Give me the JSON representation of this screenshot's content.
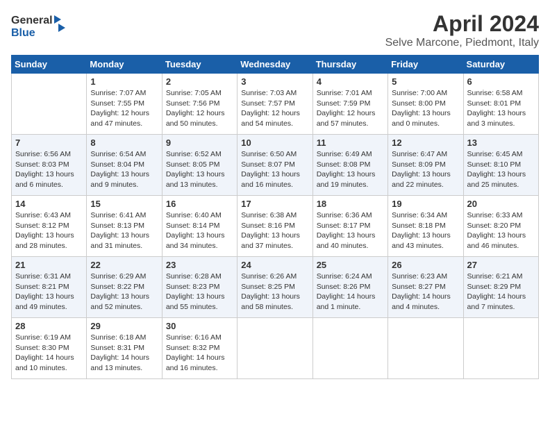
{
  "logo": {
    "line1": "General",
    "line2": "Blue"
  },
  "title": "April 2024",
  "subtitle": "Selve Marcone, Piedmont, Italy",
  "weekdays": [
    "Sunday",
    "Monday",
    "Tuesday",
    "Wednesday",
    "Thursday",
    "Friday",
    "Saturday"
  ],
  "weeks": [
    [
      {
        "day": "",
        "info": ""
      },
      {
        "day": "1",
        "info": "Sunrise: 7:07 AM\nSunset: 7:55 PM\nDaylight: 12 hours\nand 47 minutes."
      },
      {
        "day": "2",
        "info": "Sunrise: 7:05 AM\nSunset: 7:56 PM\nDaylight: 12 hours\nand 50 minutes."
      },
      {
        "day": "3",
        "info": "Sunrise: 7:03 AM\nSunset: 7:57 PM\nDaylight: 12 hours\nand 54 minutes."
      },
      {
        "day": "4",
        "info": "Sunrise: 7:01 AM\nSunset: 7:59 PM\nDaylight: 12 hours\nand 57 minutes."
      },
      {
        "day": "5",
        "info": "Sunrise: 7:00 AM\nSunset: 8:00 PM\nDaylight: 13 hours\nand 0 minutes."
      },
      {
        "day": "6",
        "info": "Sunrise: 6:58 AM\nSunset: 8:01 PM\nDaylight: 13 hours\nand 3 minutes."
      }
    ],
    [
      {
        "day": "7",
        "info": "Sunrise: 6:56 AM\nSunset: 8:03 PM\nDaylight: 13 hours\nand 6 minutes."
      },
      {
        "day": "8",
        "info": "Sunrise: 6:54 AM\nSunset: 8:04 PM\nDaylight: 13 hours\nand 9 minutes."
      },
      {
        "day": "9",
        "info": "Sunrise: 6:52 AM\nSunset: 8:05 PM\nDaylight: 13 hours\nand 13 minutes."
      },
      {
        "day": "10",
        "info": "Sunrise: 6:50 AM\nSunset: 8:07 PM\nDaylight: 13 hours\nand 16 minutes."
      },
      {
        "day": "11",
        "info": "Sunrise: 6:49 AM\nSunset: 8:08 PM\nDaylight: 13 hours\nand 19 minutes."
      },
      {
        "day": "12",
        "info": "Sunrise: 6:47 AM\nSunset: 8:09 PM\nDaylight: 13 hours\nand 22 minutes."
      },
      {
        "day": "13",
        "info": "Sunrise: 6:45 AM\nSunset: 8:10 PM\nDaylight: 13 hours\nand 25 minutes."
      }
    ],
    [
      {
        "day": "14",
        "info": "Sunrise: 6:43 AM\nSunset: 8:12 PM\nDaylight: 13 hours\nand 28 minutes."
      },
      {
        "day": "15",
        "info": "Sunrise: 6:41 AM\nSunset: 8:13 PM\nDaylight: 13 hours\nand 31 minutes."
      },
      {
        "day": "16",
        "info": "Sunrise: 6:40 AM\nSunset: 8:14 PM\nDaylight: 13 hours\nand 34 minutes."
      },
      {
        "day": "17",
        "info": "Sunrise: 6:38 AM\nSunset: 8:16 PM\nDaylight: 13 hours\nand 37 minutes."
      },
      {
        "day": "18",
        "info": "Sunrise: 6:36 AM\nSunset: 8:17 PM\nDaylight: 13 hours\nand 40 minutes."
      },
      {
        "day": "19",
        "info": "Sunrise: 6:34 AM\nSunset: 8:18 PM\nDaylight: 13 hours\nand 43 minutes."
      },
      {
        "day": "20",
        "info": "Sunrise: 6:33 AM\nSunset: 8:20 PM\nDaylight: 13 hours\nand 46 minutes."
      }
    ],
    [
      {
        "day": "21",
        "info": "Sunrise: 6:31 AM\nSunset: 8:21 PM\nDaylight: 13 hours\nand 49 minutes."
      },
      {
        "day": "22",
        "info": "Sunrise: 6:29 AM\nSunset: 8:22 PM\nDaylight: 13 hours\nand 52 minutes."
      },
      {
        "day": "23",
        "info": "Sunrise: 6:28 AM\nSunset: 8:23 PM\nDaylight: 13 hours\nand 55 minutes."
      },
      {
        "day": "24",
        "info": "Sunrise: 6:26 AM\nSunset: 8:25 PM\nDaylight: 13 hours\nand 58 minutes."
      },
      {
        "day": "25",
        "info": "Sunrise: 6:24 AM\nSunset: 8:26 PM\nDaylight: 14 hours\nand 1 minute."
      },
      {
        "day": "26",
        "info": "Sunrise: 6:23 AM\nSunset: 8:27 PM\nDaylight: 14 hours\nand 4 minutes."
      },
      {
        "day": "27",
        "info": "Sunrise: 6:21 AM\nSunset: 8:29 PM\nDaylight: 14 hours\nand 7 minutes."
      }
    ],
    [
      {
        "day": "28",
        "info": "Sunrise: 6:19 AM\nSunset: 8:30 PM\nDaylight: 14 hours\nand 10 minutes."
      },
      {
        "day": "29",
        "info": "Sunrise: 6:18 AM\nSunset: 8:31 PM\nDaylight: 14 hours\nand 13 minutes."
      },
      {
        "day": "30",
        "info": "Sunrise: 6:16 AM\nSunset: 8:32 PM\nDaylight: 14 hours\nand 16 minutes."
      },
      {
        "day": "",
        "info": ""
      },
      {
        "day": "",
        "info": ""
      },
      {
        "day": "",
        "info": ""
      },
      {
        "day": "",
        "info": ""
      }
    ]
  ]
}
